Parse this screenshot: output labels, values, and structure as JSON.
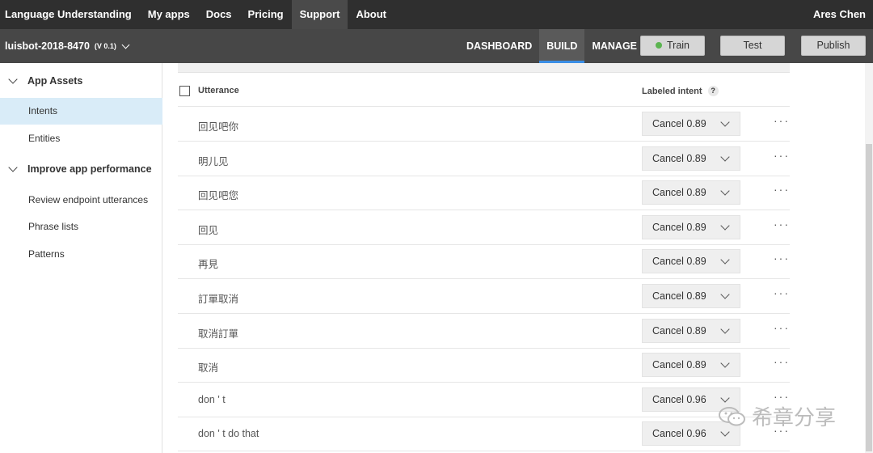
{
  "topnav": {
    "items": [
      "Language Understanding",
      "My apps",
      "Docs",
      "Pricing",
      "Support",
      "About"
    ],
    "active_index": 4,
    "user": "Ares Chen"
  },
  "appbar": {
    "app_name": "luisbot-2018-8470",
    "version": "(V 0.1)",
    "tabs": [
      "DASHBOARD",
      "BUILD",
      "MANAGE"
    ],
    "active_tab": "BUILD",
    "train_label": "Train",
    "test_label": "Test",
    "publish_label": "Publish",
    "train_status_color": "#5bb450"
  },
  "sidebar": {
    "sections": [
      {
        "label": "App Assets",
        "items": [
          "Intents",
          "Entities"
        ]
      },
      {
        "label": "Improve app performance",
        "items": [
          "Review endpoint utterances",
          "Phrase lists",
          "Patterns"
        ]
      }
    ],
    "active_item": "Intents"
  },
  "table": {
    "col_utterance": "Utterance",
    "col_intent": "Labeled intent",
    "help": "?",
    "rows": [
      {
        "utterance": "回见吧你",
        "intent": "Cancel 0.89"
      },
      {
        "utterance": "明儿见",
        "intent": "Cancel 0.89"
      },
      {
        "utterance": "回见吧您",
        "intent": "Cancel 0.89"
      },
      {
        "utterance": "回见",
        "intent": "Cancel 0.89"
      },
      {
        "utterance": "再見",
        "intent": "Cancel 0.89"
      },
      {
        "utterance": "訂單取消",
        "intent": "Cancel 0.89"
      },
      {
        "utterance": "取消訂單",
        "intent": "Cancel 0.89"
      },
      {
        "utterance": "取消",
        "intent": "Cancel 0.89"
      },
      {
        "utterance": "don ' t",
        "intent": "Cancel 0.96"
      },
      {
        "utterance": "don ' t do that",
        "intent": "Cancel 0.96"
      }
    ],
    "more": "···"
  },
  "watermark": "希章分享"
}
